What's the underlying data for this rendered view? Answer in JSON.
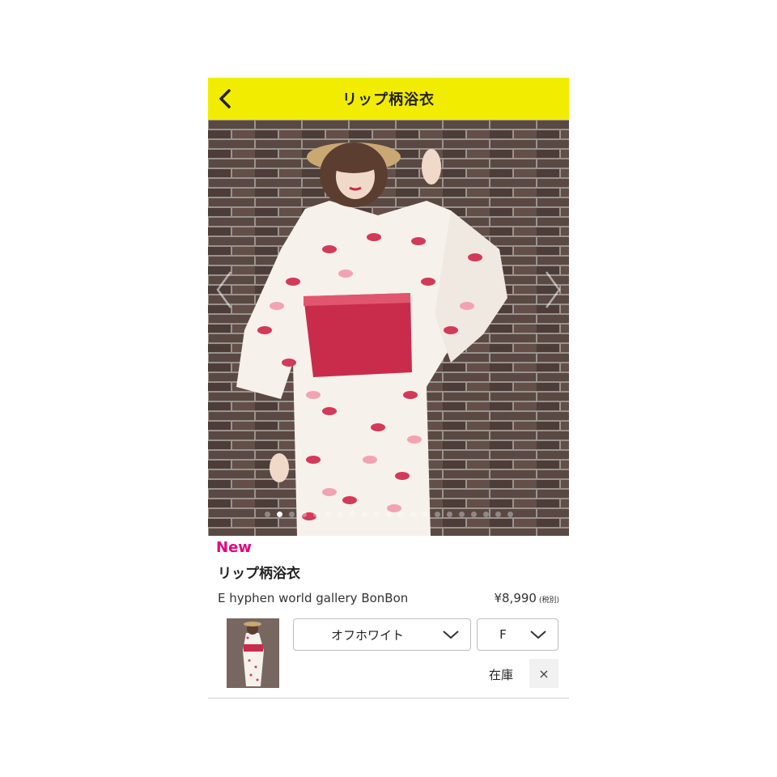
{
  "header": {
    "title": "リップ柄浴衣",
    "back_icon": "chevron-left-icon",
    "background": "#f2ec00"
  },
  "carousel": {
    "image": "kimono-model-photo",
    "slide_count": 21,
    "active_index": 1,
    "prev_icon": "chevron-left-icon",
    "next_icon": "chevron-right-icon"
  },
  "product": {
    "badge": "New",
    "badge_color": "#e6007e",
    "name": "リップ柄浴衣",
    "brand": "E hyphen world gallery BonBon",
    "price": "¥8,990",
    "tax_note": "(税別)"
  },
  "cart_item": {
    "color": "オフホワイト",
    "size": "F",
    "stock": "在庫",
    "remove_icon": "close-icon",
    "remove_label": "×"
  }
}
